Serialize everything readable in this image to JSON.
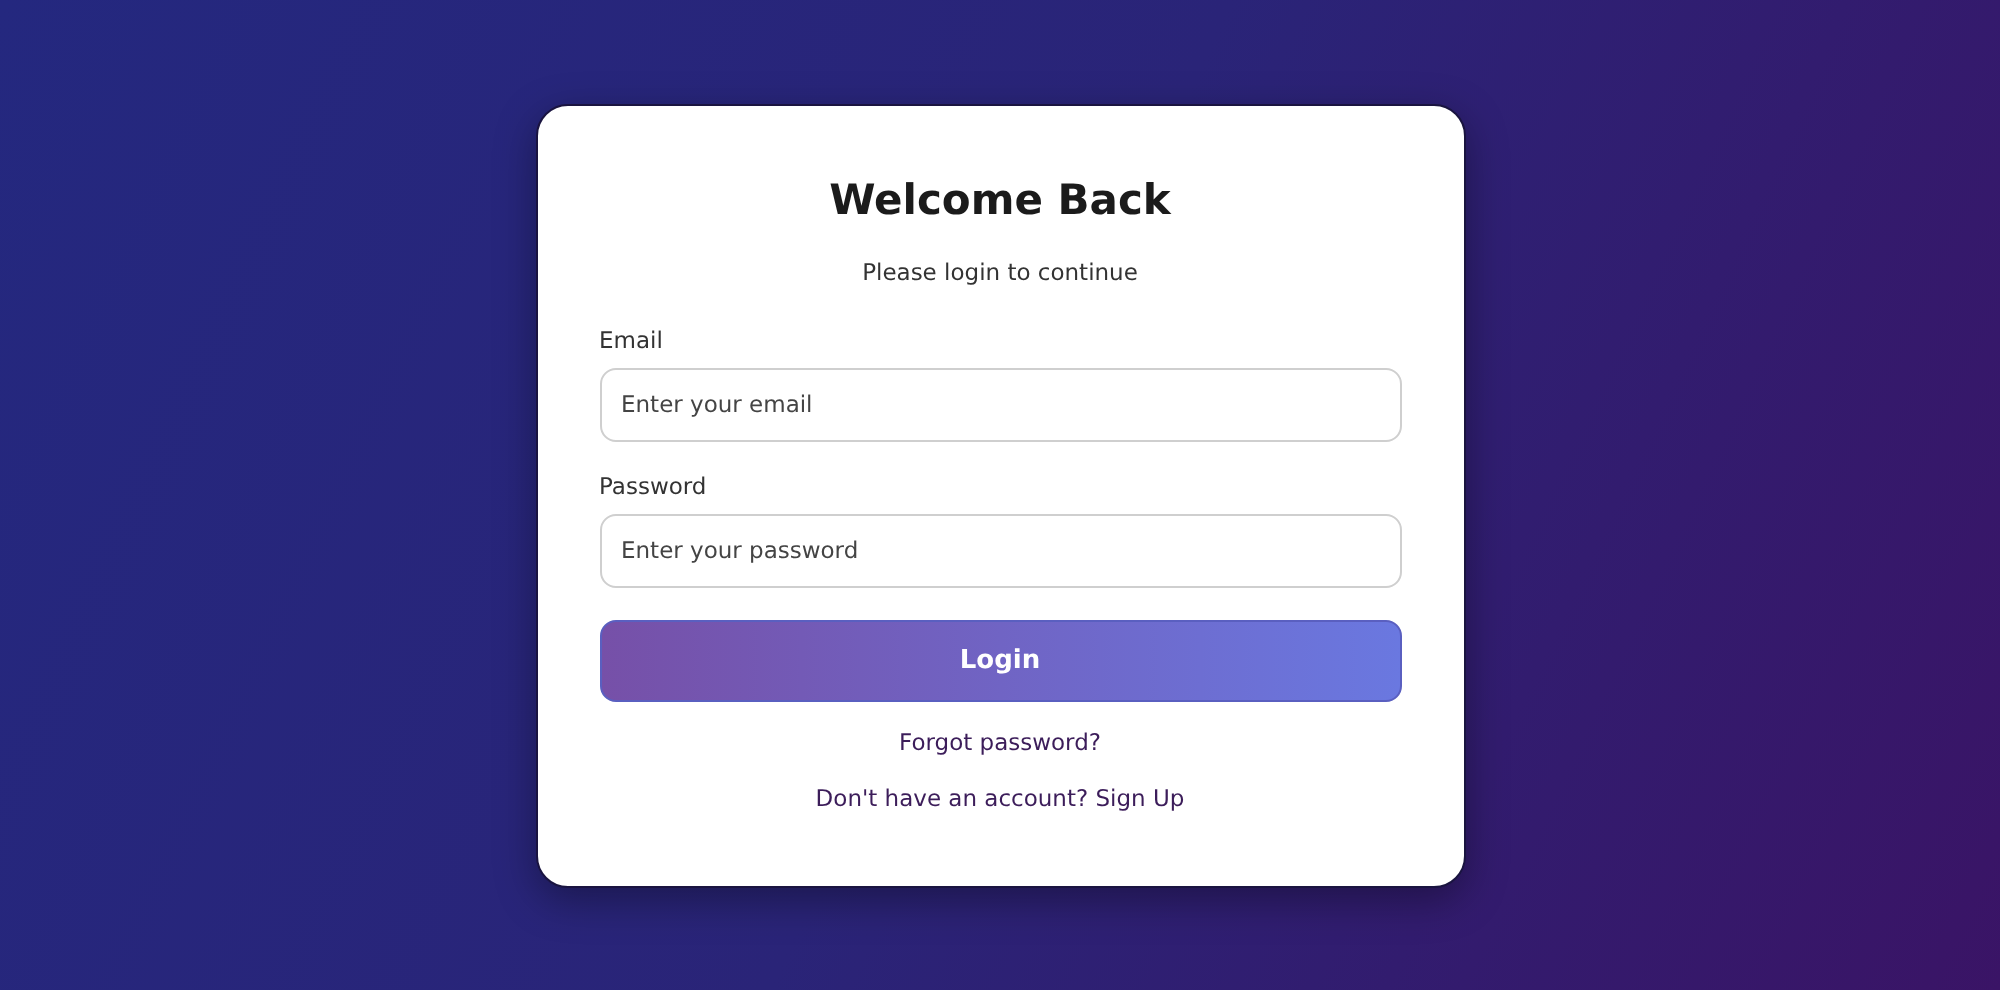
{
  "title": "Welcome Back",
  "subtitle": "Please login to continue",
  "fields": [
    {
      "label": "Email",
      "placeholder": "Enter your email"
    },
    {
      "label": "Password",
      "placeholder": "Enter your password"
    }
  ],
  "button": "Login",
  "links": [
    "Forgot password?",
    "Don't have an account? Sign Up"
  ]
}
